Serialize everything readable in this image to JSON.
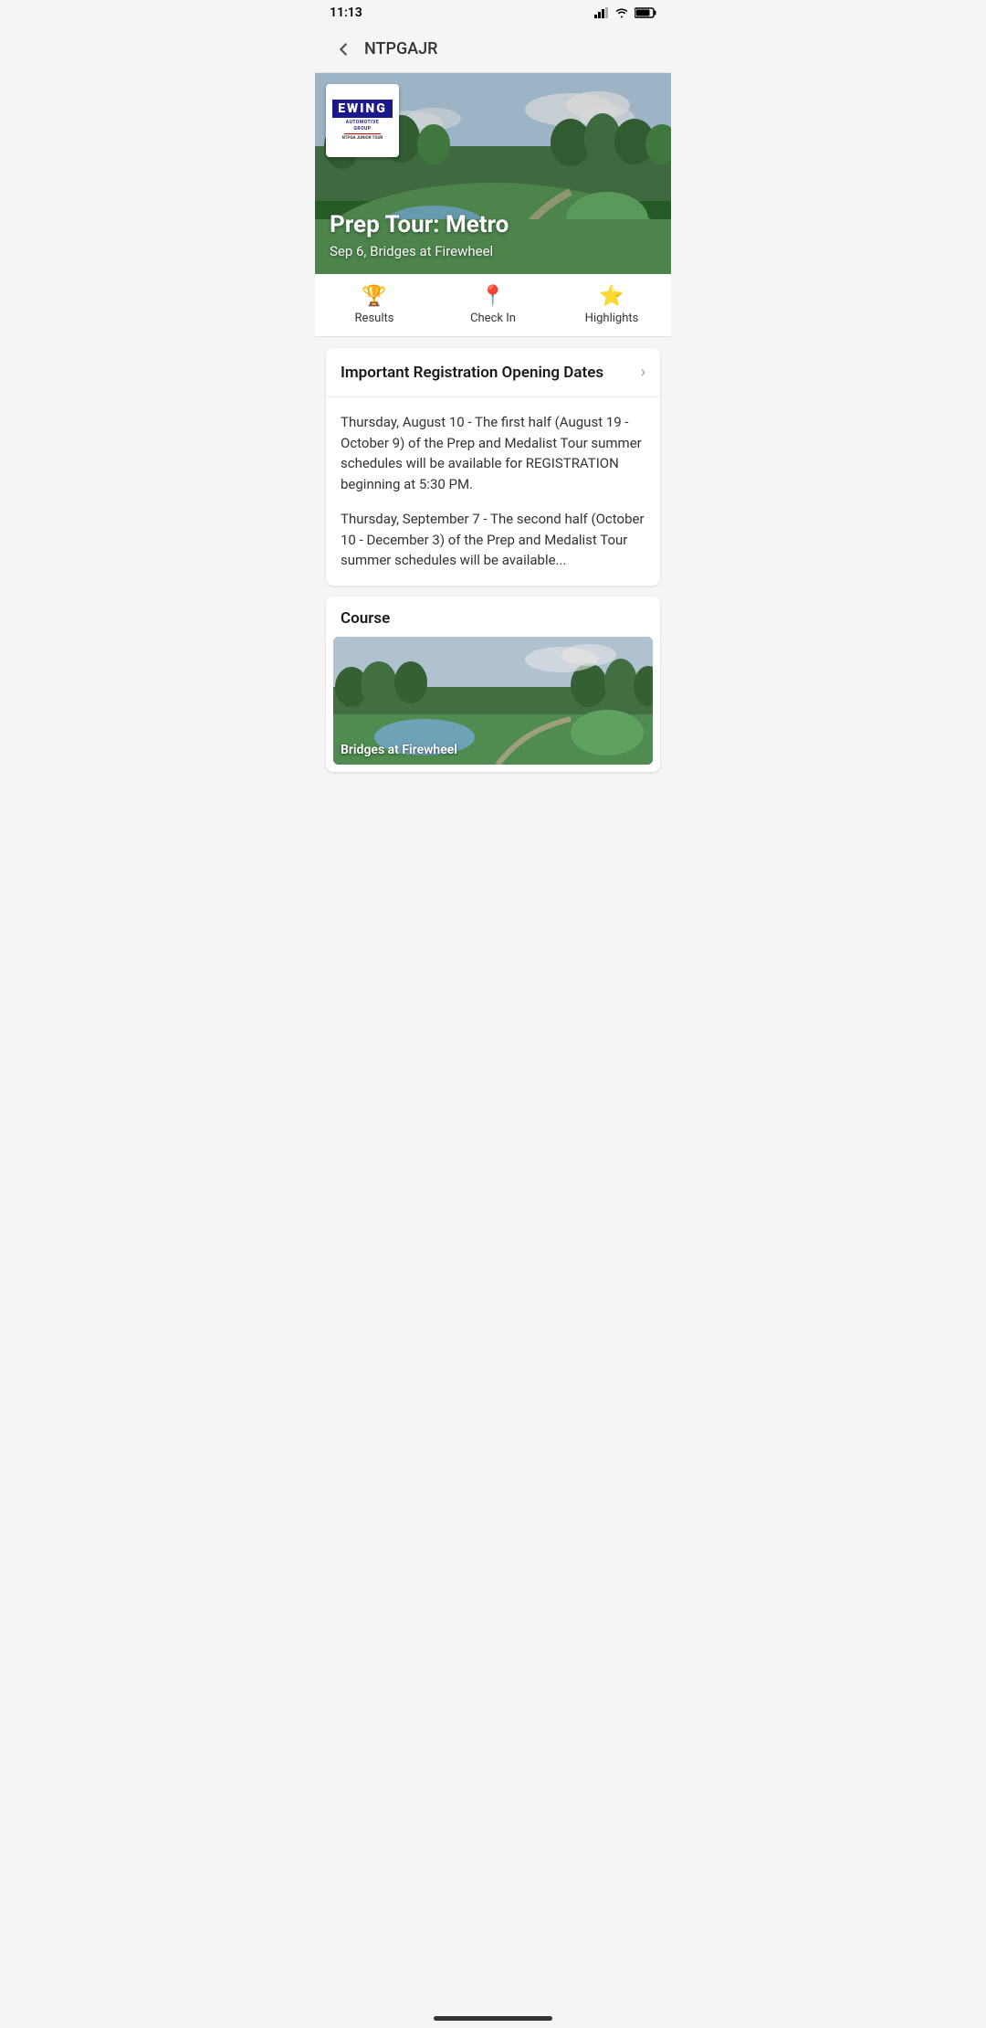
{
  "statusBar": {
    "time": "11:13"
  },
  "navBar": {
    "title": "NTPGAJR",
    "backLabel": "Back"
  },
  "hero": {
    "title": "Prep Tour: Metro",
    "subtitle": "Sep 6, Bridges at Firewheel",
    "logoLine1": "EWING",
    "logoLine2": "AUTOMOTIVE",
    "logoLine3": "GROUP",
    "logoLine4": "NTPGA JUNIOR TOUR"
  },
  "tabs": [
    {
      "id": "results",
      "label": "Results",
      "icon": "trophy"
    },
    {
      "id": "checkin",
      "label": "Check In",
      "icon": "location"
    },
    {
      "id": "highlights",
      "label": "Highlights",
      "icon": "star"
    }
  ],
  "registrationCard": {
    "title": "Important Registration Opening Dates",
    "paragraphs": [
      "Thursday, August 10 - The first half (August 19 - October 9) of the Prep and Medalist Tour summer schedules will be available for REGISTRATION beginning at 5:30 PM.",
      "Thursday, September 7 - The second half (October 10 - December 3) of the Prep and Medalist Tour summer schedules will be available..."
    ]
  },
  "courseCard": {
    "label": "Course",
    "imageName": "Bridges at Firewheel",
    "imageCaption": "Bridges at Firewheel"
  }
}
